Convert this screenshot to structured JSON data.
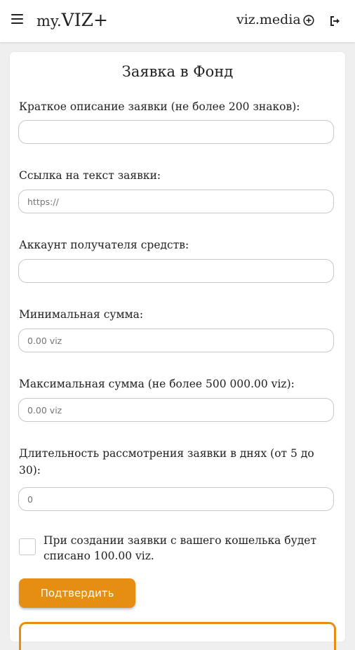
{
  "header": {
    "brand_prefix": "my.",
    "brand_main": "VIZ+",
    "site_link": "viz.media"
  },
  "form": {
    "title": "Заявка в Фонд",
    "fields": [
      {
        "label": "Краткое описание заявки (не более 200 знаков):",
        "placeholder": ""
      },
      {
        "label": "Ссылка на текст заявки:",
        "placeholder": "https://"
      },
      {
        "label": "Аккаунт получателя средств:",
        "placeholder": ""
      },
      {
        "label": "Минимальная сумма:",
        "placeholder": "0.00 viz"
      },
      {
        "label": "Максимальная сумма (не более 500 000.00 viz):",
        "placeholder": "0.00 viz"
      },
      {
        "label": "Длительность рассмотрения заявки в днях (от 5 до 30):",
        "placeholder": "0"
      }
    ],
    "checkbox_label": "При создании заявки с вашего кошелька будет списано 100.00 viz.",
    "submit_label": "Подтвердить"
  },
  "colors": {
    "accent": "#e58e12",
    "background": "#efefef",
    "card": "#ffffff"
  },
  "icons": {
    "menu": "hamburger-menu-icon",
    "add": "circle-plus-icon",
    "logout": "logout-icon"
  }
}
